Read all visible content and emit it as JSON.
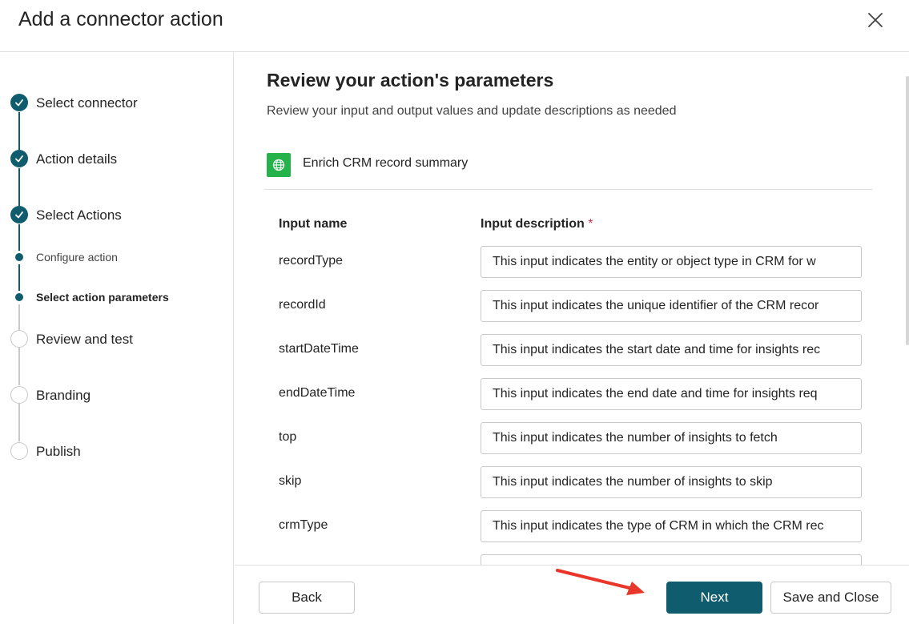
{
  "dialog": {
    "title": "Add a connector action"
  },
  "steps": [
    {
      "label": "Select connector",
      "status": "done"
    },
    {
      "label": "Action details",
      "status": "done"
    },
    {
      "label": "Select Actions",
      "status": "done"
    },
    {
      "label": "Configure action",
      "status": "substep-done"
    },
    {
      "label": "Select action parameters",
      "status": "substep-active"
    },
    {
      "label": "Review and test",
      "status": "todo"
    },
    {
      "label": "Branding",
      "status": "todo"
    },
    {
      "label": "Publish",
      "status": "todo"
    }
  ],
  "main": {
    "title": "Review your action's parameters",
    "subtitle": "Review your input and output values and update descriptions as needed",
    "action_name": "Enrich CRM record summary",
    "action_icon": "globe-icon",
    "columns": {
      "name": "Input name",
      "description": "Input description",
      "required_mark": "*"
    },
    "params": [
      {
        "name": "recordType",
        "description": "This input indicates the entity or object type in CRM for w"
      },
      {
        "name": "recordId",
        "description": "This input indicates the unique identifier of the CRM recor"
      },
      {
        "name": "startDateTime",
        "description": "This input indicates the start date and time for insights rec"
      },
      {
        "name": "endDateTime",
        "description": "This input indicates the end date and time for insights req"
      },
      {
        "name": "top",
        "description": "This input indicates the number of insights to fetch"
      },
      {
        "name": "skip",
        "description": "This input indicates the number of insights to skip"
      },
      {
        "name": "crmType",
        "description": "This input indicates the type of CRM in which the CRM rec"
      },
      {
        "name": "",
        "description": ""
      }
    ]
  },
  "footer": {
    "back_label": "Back",
    "next_label": "Next",
    "save_close_label": "Save and Close"
  },
  "colors": {
    "accent": "#0f5c6e",
    "action_icon_bg": "#23b34a",
    "annotation_arrow": "#e8372a",
    "required": "#c4314b"
  }
}
